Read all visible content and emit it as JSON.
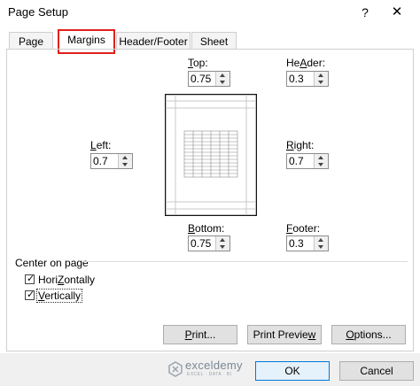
{
  "dialog": {
    "title": "Page Setup",
    "help_label": "?",
    "close_icon": "close-icon"
  },
  "tabs": [
    {
      "label": "Page",
      "active": false
    },
    {
      "label": "Margins",
      "active": true
    },
    {
      "label": "Header/Footer",
      "active": false
    },
    {
      "label": "Sheet",
      "active": false
    }
  ],
  "highlight_color": "#e0201b",
  "margins": {
    "top": {
      "label": "Top:",
      "mnemonic": "T",
      "rest": "op:",
      "value": "0.75"
    },
    "header": {
      "label": "Header:",
      "mnemonic": "A",
      "pre": "He",
      "rest": "der:",
      "value": "0.3"
    },
    "left": {
      "label": "Left:",
      "mnemonic": "L",
      "rest": "eft:",
      "value": "0.7"
    },
    "right": {
      "label": "Right:",
      "mnemonic": "R",
      "rest": "ight:",
      "value": "0.7"
    },
    "bottom": {
      "label": "Bottom:",
      "mnemonic": "B",
      "rest": "ottom:",
      "value": "0.75"
    },
    "footer": {
      "label": "Footer:",
      "mnemonic": "F",
      "rest": "ooter:",
      "value": "0.3"
    }
  },
  "center_on_page": {
    "section_label": "Center on page",
    "horizontally": {
      "label": "Horizontally",
      "mnemonic": "Z",
      "pre": "Hori",
      "rest": "ontally",
      "checked": true
    },
    "vertically": {
      "label": "Vertically",
      "mnemonic": "V",
      "rest": "ertically",
      "checked": true
    }
  },
  "buttons": {
    "print": {
      "label": "Print...",
      "mnemonic": "P",
      "rest": "rint..."
    },
    "print_preview": {
      "label": "Print Preview",
      "pre": "Print Previe",
      "mnemonic": "w",
      "rest": ""
    },
    "options": {
      "label": "Options...",
      "mnemonic": "O",
      "rest": "ptions..."
    },
    "ok": {
      "label": "OK"
    },
    "cancel": {
      "label": "Cancel"
    }
  },
  "watermark": {
    "name": "exceldemy",
    "tagline": "EXCEL · DATA · BI"
  }
}
